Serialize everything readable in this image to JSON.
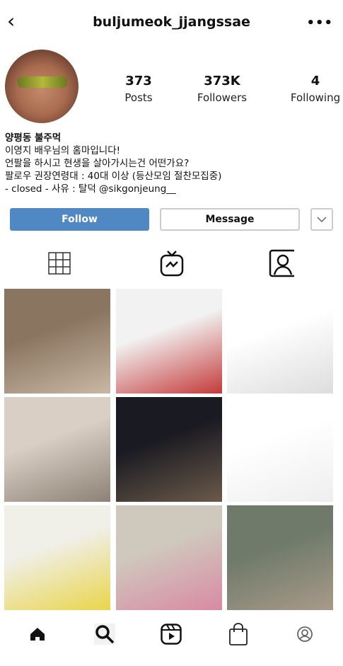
{
  "header": {
    "username": "buljumeok_jjangssae",
    "back_icon": "chevron-left-icon",
    "more_icon": "more-horizontal-icon"
  },
  "profile": {
    "stats": [
      {
        "value": "373",
        "label": "Posts"
      },
      {
        "value": "373K",
        "label": "Followers"
      },
      {
        "value": "4",
        "label": "Following"
      }
    ],
    "name": "양평동 불주먹",
    "bio": [
      "이영지 배우님의 홈마입니다!",
      "언팔을 하시고 현생을 살아가시는건 어떤가요?",
      "팔로우 권장연령대 : 40대 이상 (등산모임 절찬모집중)",
      "- closed - 사유 : 탈덕 @sikgonjeung__"
    ]
  },
  "actions": {
    "follow": "Follow",
    "message": "Message",
    "dropdown_icon": "chevron-down-icon"
  },
  "colors": {
    "follow": "#5088c4"
  },
  "tabs": [
    {
      "icon": "grid-icon"
    },
    {
      "icon": "igtv-icon"
    },
    {
      "icon": "tagged-icon"
    }
  ],
  "posts": [
    {
      "colors": [
        "#8a7560",
        "#c9b8a5"
      ]
    },
    {
      "colors": [
        "#f2f2f2",
        "#c43a3a"
      ]
    },
    {
      "colors": [
        "#ffffff",
        "#dddddd"
      ]
    },
    {
      "colors": [
        "#d9cfc4",
        "#8e8276"
      ]
    },
    {
      "colors": [
        "#1a1a22",
        "#6b5a4a"
      ]
    },
    {
      "colors": [
        "#ffffff",
        "#eeeeee"
      ]
    },
    {
      "colors": [
        "#f0efe8",
        "#e9d54a"
      ]
    },
    {
      "colors": [
        "#cfc8bd",
        "#d98aa4"
      ]
    },
    {
      "colors": [
        "#6f7a6a",
        "#a89a8a"
      ]
    }
  ],
  "bottom_nav": [
    "home-icon",
    "search-icon",
    "reels-icon",
    "shop-icon",
    "profile-icon"
  ]
}
